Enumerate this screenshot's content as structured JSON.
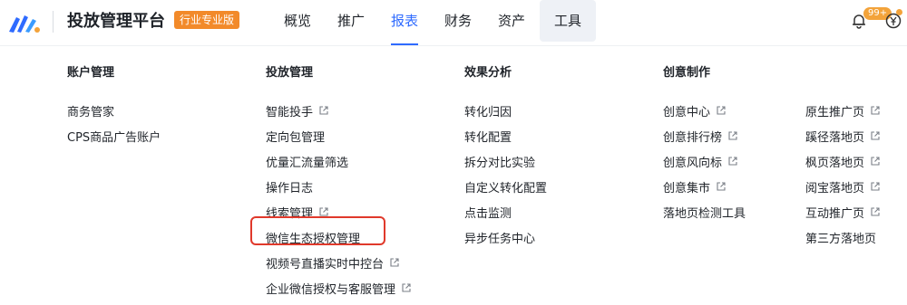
{
  "header": {
    "brand": "投放管理平台",
    "edition_badge": "行业专业版",
    "nav": [
      "概览",
      "推广",
      "报表",
      "财务",
      "资产",
      "工具"
    ],
    "active_nav": "报表",
    "notification_count": "99+"
  },
  "columns": {
    "account": {
      "title": "账户管理",
      "items": [
        {
          "label": "商务管家",
          "external": false
        },
        {
          "label": "CPS商品广告账户",
          "external": false
        }
      ]
    },
    "delivery": {
      "title": "投放管理",
      "items": [
        {
          "label": "智能投手",
          "external": true
        },
        {
          "label": "定向包管理",
          "external": false
        },
        {
          "label": "优量汇流量筛选",
          "external": false
        },
        {
          "label": "操作日志",
          "external": false
        },
        {
          "label": "线索管理",
          "external": true
        },
        {
          "label": "微信生态授权管理",
          "external": false
        },
        {
          "label": "视频号直播实时中控台",
          "external": true
        },
        {
          "label": "企业微信授权与客服管理",
          "external": true
        }
      ]
    },
    "analysis": {
      "title": "效果分析",
      "items": [
        {
          "label": "转化归因",
          "external": false
        },
        {
          "label": "转化配置",
          "external": false
        },
        {
          "label": "拆分对比实验",
          "external": false
        },
        {
          "label": "自定义转化配置",
          "external": false
        },
        {
          "label": "点击监测",
          "external": false
        },
        {
          "label": "异步任务中心",
          "external": false
        }
      ]
    },
    "creative": {
      "title": "创意制作",
      "items": [
        {
          "label": "创意中心",
          "external": true
        },
        {
          "label": "创意排行榜",
          "external": true
        },
        {
          "label": "创意风向标",
          "external": true
        },
        {
          "label": "创意集市",
          "external": true
        },
        {
          "label": "落地页检测工具",
          "external": false
        }
      ]
    },
    "landing": {
      "items": [
        {
          "label": "原生推广页",
          "external": true
        },
        {
          "label": "蹊径落地页",
          "external": true
        },
        {
          "label": "枫页落地页",
          "external": true
        },
        {
          "label": "阅宝落地页",
          "external": true
        },
        {
          "label": "互动推广页",
          "external": true
        },
        {
          "label": "第三方落地页",
          "external": false
        }
      ]
    }
  },
  "colors": {
    "accent": "#2f6bff",
    "badge": "#f28a2a",
    "highlight": "#e0392b"
  }
}
